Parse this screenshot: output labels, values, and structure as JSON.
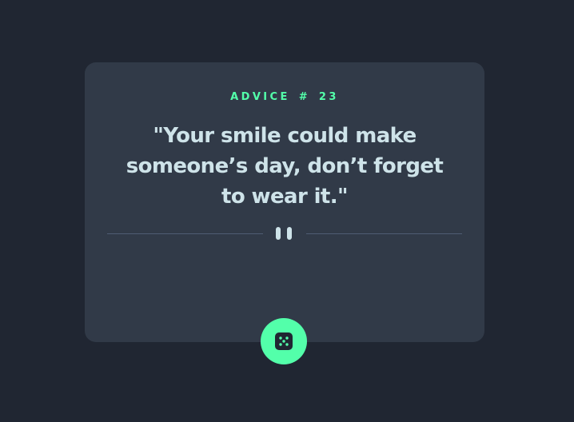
{
  "advice": {
    "label": "ADVICE",
    "hash": "#",
    "number": "23",
    "quote": "\"Your smile could make someone’s day, don’t forget to wear it.\""
  },
  "icons": {
    "divider": "pause-icon",
    "button": "dice-icon"
  },
  "colors": {
    "background": "#202632",
    "card": "#313A48",
    "accent": "#53FFAA",
    "text": "#CEE3E9",
    "divider": "#4F5D74"
  }
}
